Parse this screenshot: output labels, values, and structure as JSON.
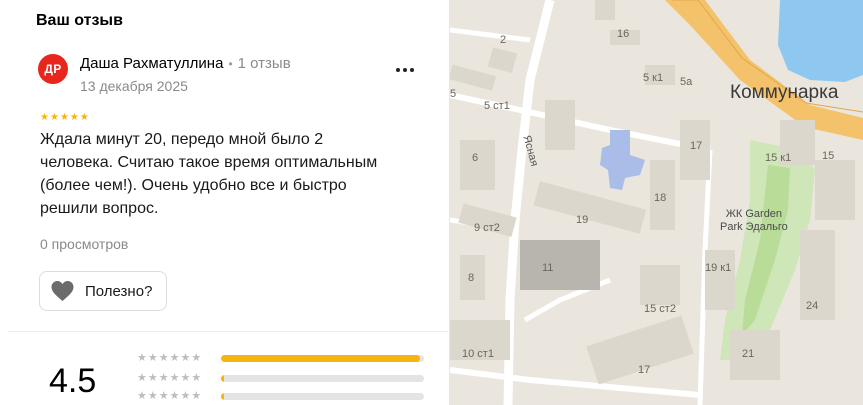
{
  "review_section": {
    "title": "Ваш отзыв",
    "avatar_initials": "ДР",
    "author": "Даша Рахматуллина",
    "separator": "•",
    "review_count": "1 отзыв",
    "date": "13 декабря 2025",
    "more_menu": "...",
    "star_rating": 5,
    "text": "Ждала минут 20, передо мной было 2 человека. Считаю такое время оптимальным (более чем!). Очень удобно все и быстро решили вопрос.",
    "views": "0 просмотров",
    "useful_label": "Полезно?"
  },
  "rating_summary": {
    "average": "4.5",
    "distribution": [
      {
        "stars": 5,
        "fraction": 0.98
      },
      {
        "stars": 4,
        "fraction": 0.01
      },
      {
        "stars": 3,
        "fraction": 0.01
      }
    ]
  },
  "map": {
    "city_label": "Коммунарка",
    "street_label": "Ясная",
    "complex_label_line1": "ЖК Garden",
    "complex_label_line2": "Park Эдальго",
    "house_numbers": [
      "2",
      "16",
      "5 к1",
      "5а",
      "5",
      "5 ст1",
      "6",
      "17",
      "15 к1",
      "15",
      "18",
      "19",
      "9 ст2",
      "11",
      "19 к1",
      "8",
      "15 ст2",
      "24",
      "10 ст1",
      "17",
      "21"
    ],
    "colors": {
      "background": "#eae6dd",
      "road": "#ffffff",
      "highway": "#f3c26b",
      "water": "#8ec8f0",
      "park": "#cfe6b8",
      "building": "#dcd7cc",
      "highlight_building": "#a9bde8"
    }
  },
  "colors": {
    "accent_star": "#f5b50f",
    "avatar_bg": "#e8261e"
  }
}
